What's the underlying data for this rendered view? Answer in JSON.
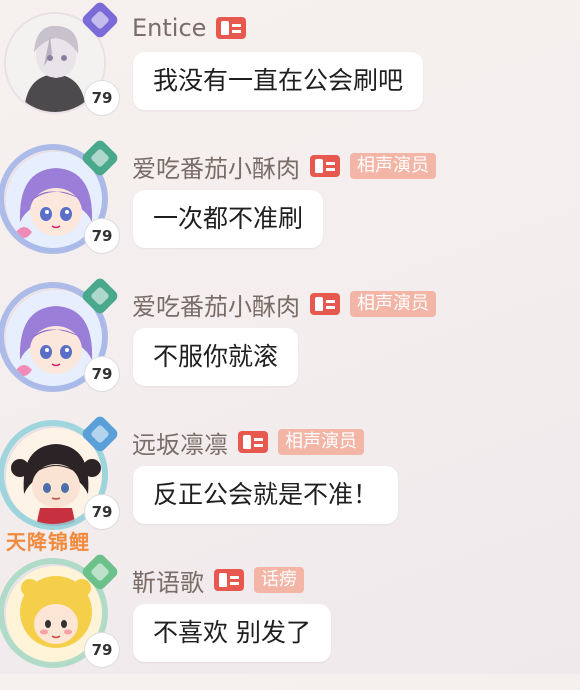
{
  "messages": [
    {
      "name": "Entice",
      "level": "79",
      "title": "",
      "text": "我没有一直在公会刷吧",
      "rank_color": "#7b6bd6",
      "avatar_icon": "grey-hair-boy-avatar"
    },
    {
      "name": "爱吃番茄小酥肉",
      "level": "79",
      "title": "相声演员",
      "text": "一次都不准刷",
      "rank_color": "#4aa88c",
      "avatar_icon": "purple-hair-girl-avatar"
    },
    {
      "name": "爱吃番茄小酥肉",
      "level": "79",
      "title": "相声演员",
      "text": "不服你就滚",
      "rank_color": "#4aa88c",
      "avatar_icon": "purple-hair-girl-avatar"
    },
    {
      "name": "远坂凛凛",
      "level": "79",
      "title": "相声演员",
      "text": "反正公会就是不准！",
      "rank_color": "#5a9fd8",
      "avatar_icon": "black-twintail-girl-avatar",
      "frame_text": "天降锦鲤"
    },
    {
      "name": "靳语歌",
      "level": "79",
      "title": "话痨",
      "text": "不喜欢 别发了",
      "rank_color": "#6cc08a",
      "avatar_icon": "lion-hood-girl-avatar"
    }
  ]
}
